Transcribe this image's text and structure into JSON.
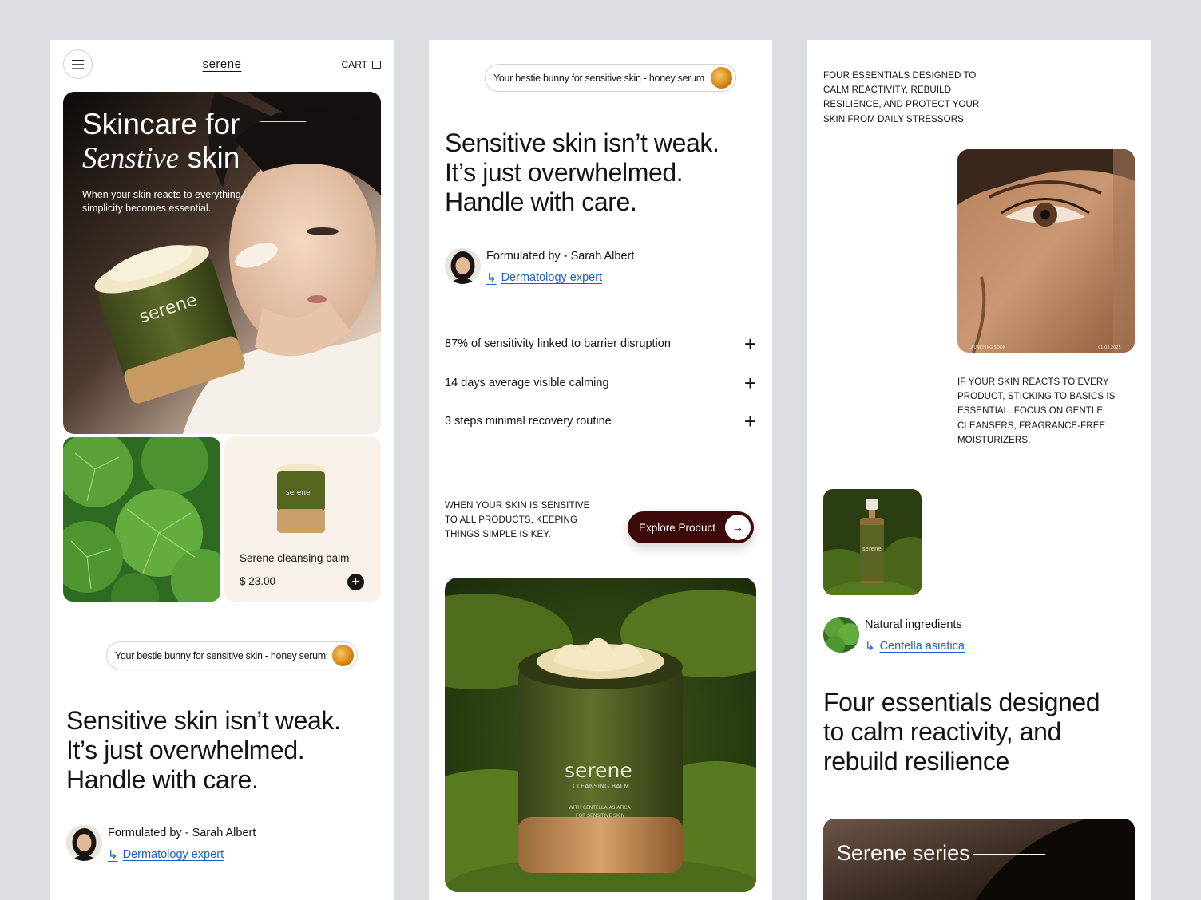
{
  "screen1": {
    "logo": "serene",
    "cart_label": "CART",
    "hero": {
      "title_line1": "Skincare for",
      "title_italic": "Senstive",
      "title_line2_rest": "skin",
      "subtitle": "When your skin reacts to everything, simplicity becomes essential."
    },
    "product": {
      "name": "Serene cleansing balm",
      "price": "$ 23.00",
      "jar_brand": "serene"
    },
    "pill_text": "Your bestie bunny for sensitive skin - honey serum",
    "headline": [
      "Sensitive skin isn’t weak.",
      "It’s just overwhelmed.",
      "Handle with care."
    ],
    "formulated_by": "Formulated by - Sarah Albert",
    "expert_link": "Dermatology expert"
  },
  "screen2": {
    "pill_text": "Your bestie bunny for sensitive skin - honey serum",
    "headline": [
      "Sensitive skin isn’t weak.",
      "It’s just overwhelmed.",
      "Handle with care."
    ],
    "formulated_by": "Formulated by - Sarah Albert",
    "expert_link": "Dermatology expert",
    "stats": [
      "87% of sensitivity linked to barrier disruption",
      "14 days average visible calming",
      "3 steps minimal recovery routine"
    ],
    "caps_note": "WHEN YOUR SKIN IS SENSITIVE TO ALL PRODUCTS, KEEPING THINGS SIMPLE IS KEY.",
    "explore_label": "Explore Product",
    "jar": {
      "brand": "serene",
      "line1": "CLEANSING BALM",
      "line2": "WITH CENTELLA ASIATICA",
      "line3": "FOR SENSITIVE SKIN"
    }
  },
  "screen3": {
    "intro_caps": "FOUR ESSENTIALS DESIGNED TO CALM REACTIVITY, REBUILD RESILIENCE, AND PROTECT YOUR SKIN FROM DAILY STRESSORS.",
    "face_caption_left": "LAUNCHING SOON",
    "face_caption_right": "01.03.2025",
    "advice_caps": "IF YOUR SKIN REACTS TO EVERY PRODUCT, STICKING TO BASICS IS ESSENTIAL. FOCUS ON GENTLE CLEANSERS, FRAGRANCE-FREE MOISTURIZERS.",
    "bottle_brand": "serene",
    "ingredients_label": "Natural ingredients",
    "ingredient_link": "Centella asiatica",
    "headline": [
      "Four essentials designed",
      "to calm reactivity, and",
      "rebuild resilience"
    ],
    "series_title": "Serene series"
  },
  "colors": {
    "accent_link": "#1f5ecd",
    "explore_bg": "#3d0a0a",
    "jar_green": "#4f5a1f",
    "page_bg": "#dcdee2"
  },
  "icons": [
    "menu-icon",
    "cart-icon",
    "plus-icon",
    "arrow-right-icon",
    "reply-arrow-icon"
  ]
}
